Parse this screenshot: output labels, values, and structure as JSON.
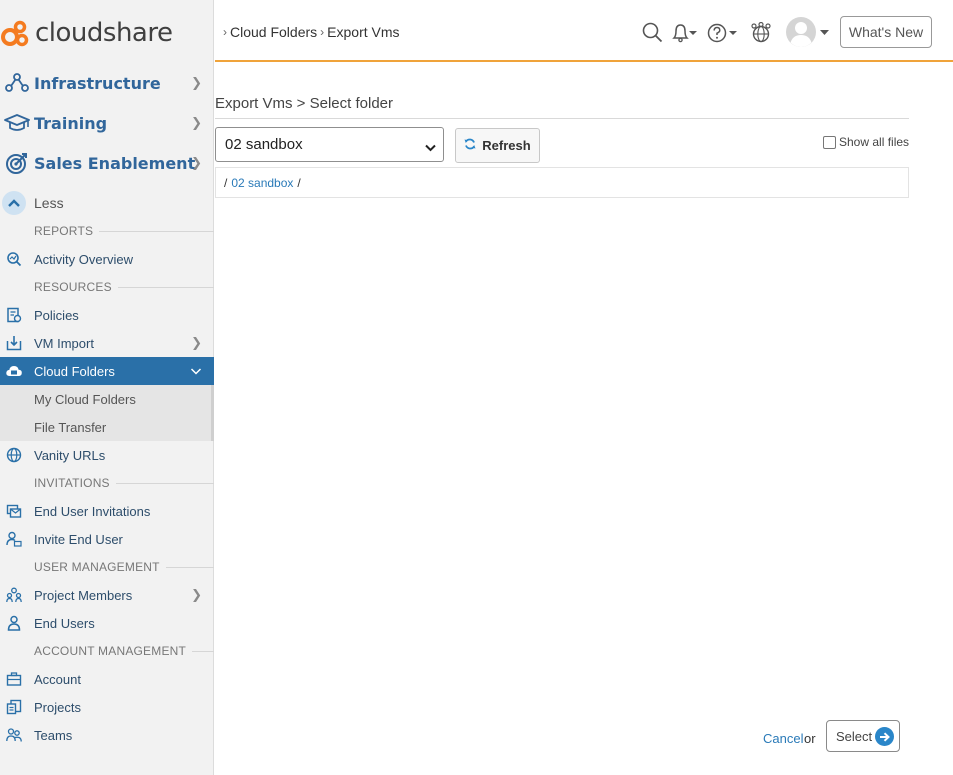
{
  "brand": {
    "name": "cloudshare",
    "accent": "#f47b20",
    "nav_blue": "#31669b",
    "active_bg": "#2a70a8",
    "header_rule": "#f0a33a"
  },
  "sidebar": {
    "main": [
      {
        "label": "Infrastructure",
        "icon": "nodes-icon"
      },
      {
        "label": "Training",
        "icon": "graduation-cap-icon"
      },
      {
        "label": "Sales Enablement",
        "icon": "target-icon"
      }
    ],
    "less_label": "Less",
    "sections": {
      "reports": "REPORTS",
      "resources": "RESOURCES",
      "invitations": "INVITATIONS",
      "user_management": "USER MANAGEMENT",
      "account_management": "ACCOUNT MANAGEMENT"
    },
    "items": {
      "activity_overview": "Activity Overview",
      "policies": "Policies",
      "vm_import": "VM Import",
      "cloud_folders": "Cloud Folders",
      "my_cloud_folders": "My Cloud Folders",
      "file_transfer": "File Transfer",
      "vanity_urls": "Vanity URLs",
      "end_user_invitations": "End User Invitations",
      "invite_end_user": "Invite End User",
      "project_members": "Project Members",
      "end_users": "End Users",
      "account": "Account",
      "projects": "Projects",
      "teams": "Teams"
    }
  },
  "header": {
    "breadcrumb": [
      "Cloud Folders",
      "Export Vms"
    ],
    "whats_new": "What's New",
    "icons": [
      "search-icon",
      "bell-icon",
      "help-icon",
      "community-icon",
      "avatar-icon"
    ]
  },
  "main": {
    "title": "Export Vms > Select folder",
    "folder_select_value": "02 sandbox",
    "refresh_label": "Refresh",
    "show_all_files": "Show all files",
    "path_prefix": "/",
    "path_link": "02 sandbox",
    "path_suffix": "/",
    "cancel_label": "Cancel",
    "or_label": "or",
    "select_label": "Select"
  }
}
